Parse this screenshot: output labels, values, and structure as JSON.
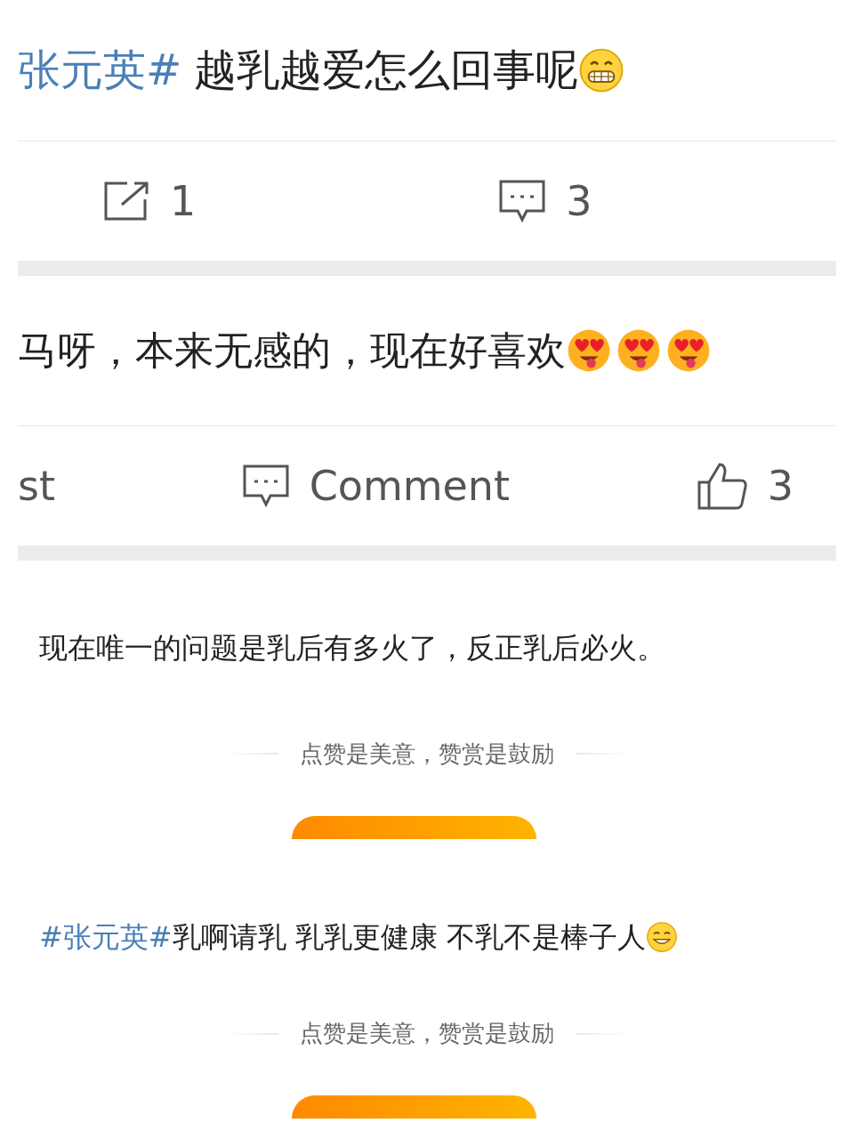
{
  "sections": [
    {
      "kind": "post",
      "hashtag": "张元英#",
      "text": "越乳越爱怎么回事呢",
      "emojis": [
        {
          "kind": "grin"
        }
      ],
      "actions": [
        {
          "kind": "share",
          "label": "1"
        },
        {
          "kind": "comment",
          "label": "3"
        }
      ]
    },
    {
      "kind": "comment",
      "text": "马呀，本来无感的，现在好喜欢",
      "emojis": [
        {
          "kind": "heart_eyes"
        },
        {
          "kind": "heart_eyes"
        },
        {
          "kind": "heart_eyes"
        }
      ],
      "actions": [
        {
          "kind": "plain",
          "label": "st"
        },
        {
          "kind": "comment",
          "label": "Comment"
        },
        {
          "kind": "like",
          "label": "3"
        }
      ]
    },
    {
      "kind": "article",
      "text": "现在唯一的问题是乳后有多火了，反正乳后必火。",
      "reward_note": "点赞是美意，赞赏是鼓励"
    },
    {
      "kind": "article",
      "hashtag": "#张元英#",
      "text": "乳啊请乳 乳乳更健康 不乳不是棒子人",
      "emojis": [
        {
          "kind": "smile"
        }
      ],
      "reward_note": "点赞是美意，赞赏是鼓励"
    }
  ]
}
